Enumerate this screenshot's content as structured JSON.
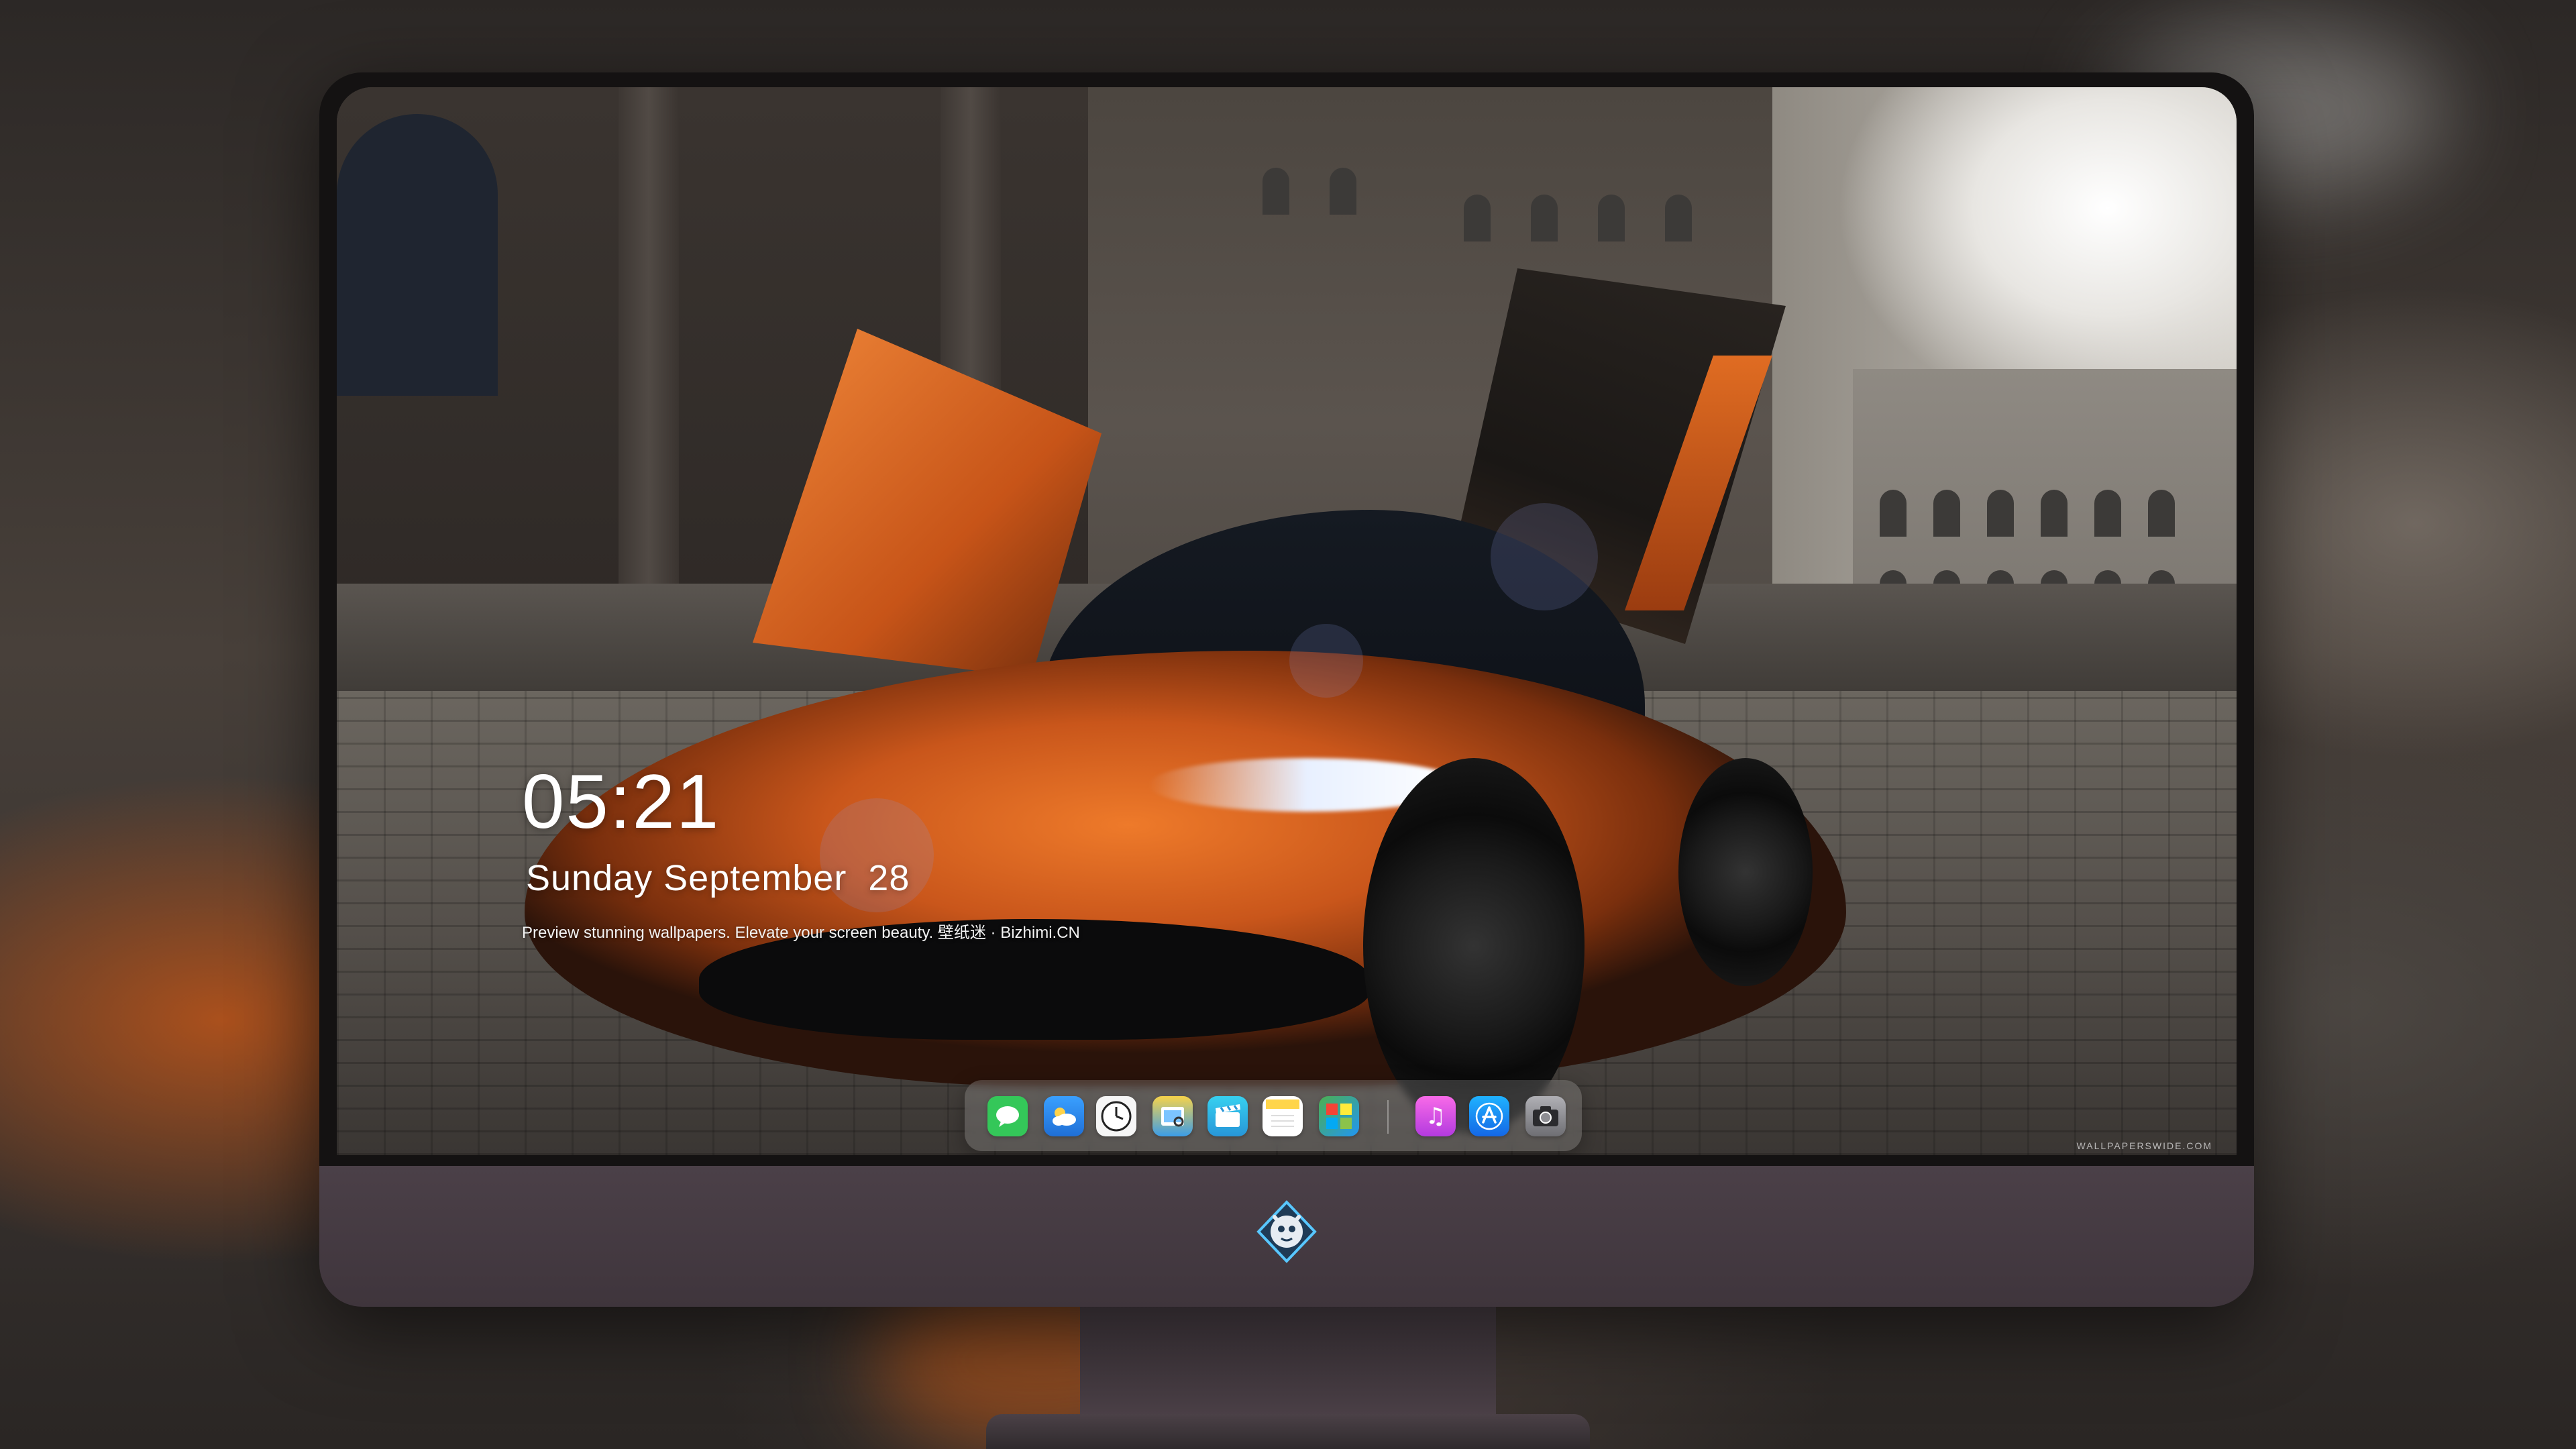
{
  "lockscreen": {
    "time": "05:21",
    "date": "Sunday September  28",
    "tagline": "Preview stunning wallpapers. Elevate your screen beauty. 壁纸迷 · Bizhimi.CN"
  },
  "wallpaper": {
    "watermark": "WALLPAPERSWIDE.COM"
  },
  "dock": {
    "apps": [
      {
        "name": "Messages",
        "icon": "messages-icon",
        "color": "#34c759"
      },
      {
        "name": "Weather",
        "icon": "weather-icon",
        "color": "#2f8ff0"
      },
      {
        "name": "Clock",
        "icon": "clock-icon",
        "color": "#ffffff"
      },
      {
        "name": "Preview",
        "icon": "preview-icon",
        "color": "#f2c230"
      },
      {
        "name": "Clips",
        "icon": "clips-icon",
        "color": "#2cc3e8"
      },
      {
        "name": "Notes",
        "icon": "notes-icon",
        "color": "#ffd54a"
      },
      {
        "name": "Photo Booth",
        "icon": "photo-booth-icon",
        "color": "#4caf50"
      },
      {
        "name": "iTunes",
        "icon": "music-icon",
        "color": "#e84cd8"
      },
      {
        "name": "App Store",
        "icon": "app-store-icon",
        "color": "#1e90ff"
      },
      {
        "name": "Camera",
        "icon": "camera-icon",
        "color": "#8e8e93"
      }
    ]
  }
}
